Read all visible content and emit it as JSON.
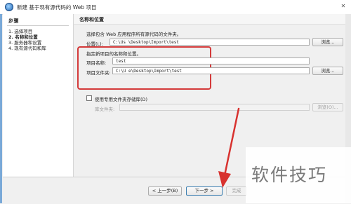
{
  "window": {
    "title": "新建 基于现有源代码的 Web 项目"
  },
  "steps": {
    "heading": "步骤",
    "items": [
      {
        "label": "1.   选择项目"
      },
      {
        "label": "2.   名称和位置"
      },
      {
        "label": "3.   服务器和设置"
      },
      {
        "label": "4.   现有源代码和库"
      }
    ]
  },
  "panel": {
    "title": "名称和位置",
    "intro": "选择包含 Web 应用程序所有源代码的文件夹。",
    "location_label": "位置(L):",
    "location_value": "C:\\Us          \\Desktop\\Import\\test",
    "browse_label": "浏览...",
    "name_section_label": "指定新项目的名称和位置。",
    "project_name_label": "项目名称:",
    "project_name_value": "test",
    "project_folder_label": "项目文件夹:",
    "project_folder_value": "C:\\U          e\\Desktop\\Import\\test",
    "browse2_label": "浏览...",
    "dedicated_folder_label": "使用专用文件夹存储库(D)",
    "libraries_folder_label": "库文件夹:",
    "libraries_folder_value": "",
    "browse3_label": "浏览(O)..."
  },
  "footer": {
    "back_label": "< 上一步(B)",
    "next_label": "下一步 >",
    "finish_label": "完成"
  },
  "watermark": {
    "text": "软件技巧"
  }
}
